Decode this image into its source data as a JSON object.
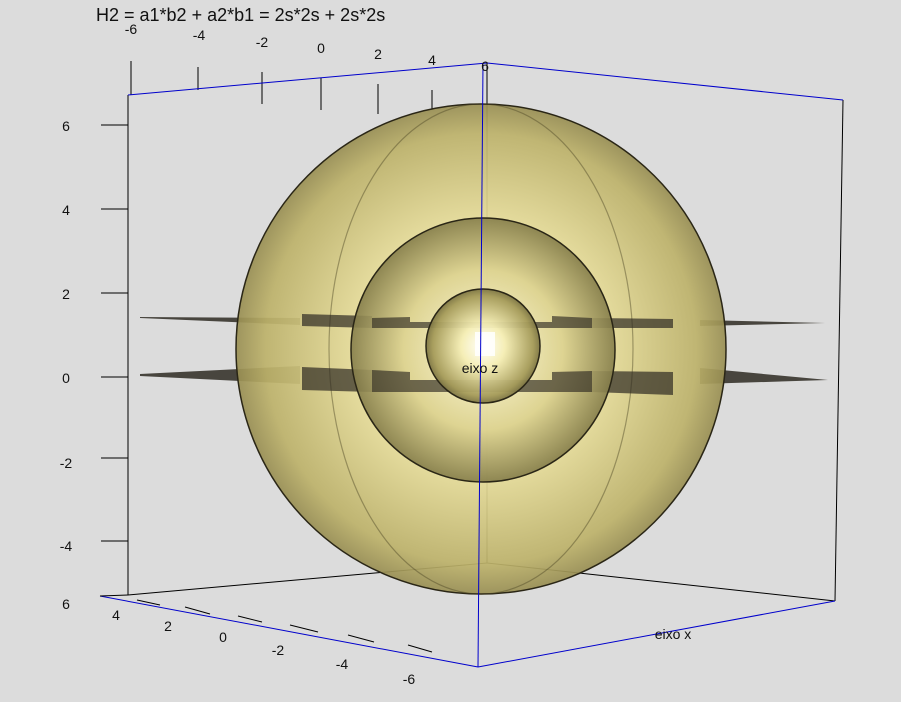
{
  "title": "H2 = a1*b2 + a2*b1 = 2s*2s + 2s*2s",
  "axis_labels": {
    "z": "eixo z",
    "x": "eixo x"
  },
  "ticks": {
    "top": [
      "-6",
      "-4",
      "-2",
      "0",
      "2",
      "4",
      "6"
    ],
    "left": [
      "6",
      "4",
      "2",
      "0",
      "-2",
      "-4",
      "6"
    ],
    "bottom": [
      "4",
      "2",
      "0",
      "-2",
      "-4",
      "-6"
    ]
  },
  "colors": {
    "background": "#dcdcdc",
    "sphere": "#d8cf8a",
    "box_front": "#0000cc",
    "box_back": "#000000",
    "plane": "#2e2a22"
  },
  "spheres": [
    {
      "name": "outer",
      "radius": 6
    },
    {
      "name": "middle",
      "radius": 3.2
    },
    {
      "name": "inner",
      "radius": 1.3
    }
  ]
}
